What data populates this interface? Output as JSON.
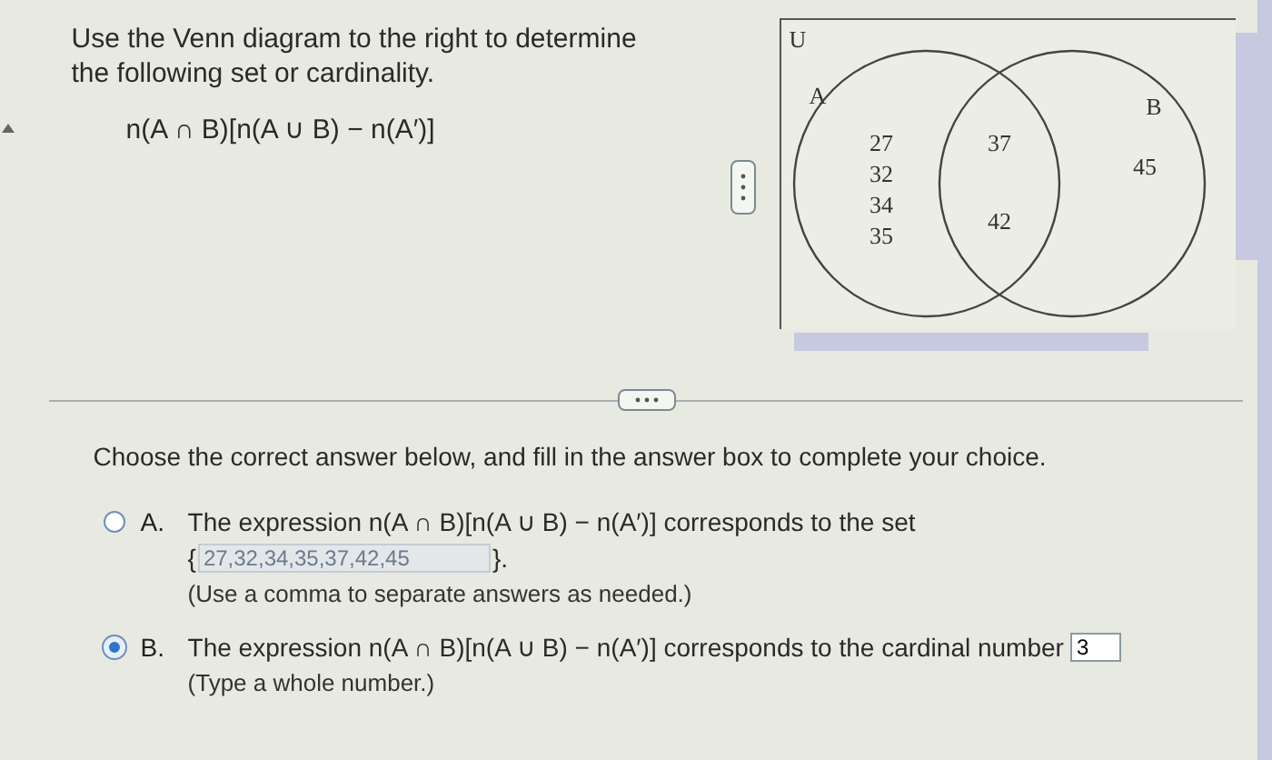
{
  "question": {
    "instruction": "Use the Venn diagram to the right to determine the following set or cardinality.",
    "expression": "n(A ∩ B)[n(A ∪ B) − n(A′)]"
  },
  "venn": {
    "universe_label": "U",
    "set_a_label": "A",
    "set_b_label": "B",
    "a_only": [
      "27",
      "32",
      "34",
      "35"
    ],
    "both": [
      "37",
      "42"
    ],
    "b_only": [
      "45"
    ]
  },
  "prompt": "Choose the correct answer below, and fill in the answer box to complete your choice.",
  "choices": [
    {
      "kind": "set",
      "letter": "A.",
      "selected": false,
      "text": "The expression n(A ∩ B)[n(A ∪ B) − n(A′)] corresponds to the set",
      "open": "{",
      "close": "}.",
      "answer": {
        "value": "27,32,34,35,37,42,45",
        "disabled": true
      },
      "hint": "(Use a comma to separate answers as needed.)"
    },
    {
      "kind": "number",
      "letter": "B.",
      "selected": true,
      "text": "The expression n(A ∩ B)[n(A ∪ B) − n(A′)] corresponds to the cardinal number",
      "answer": {
        "value": "3",
        "disabled": false
      },
      "hint": "(Type a whole number.)"
    }
  ]
}
